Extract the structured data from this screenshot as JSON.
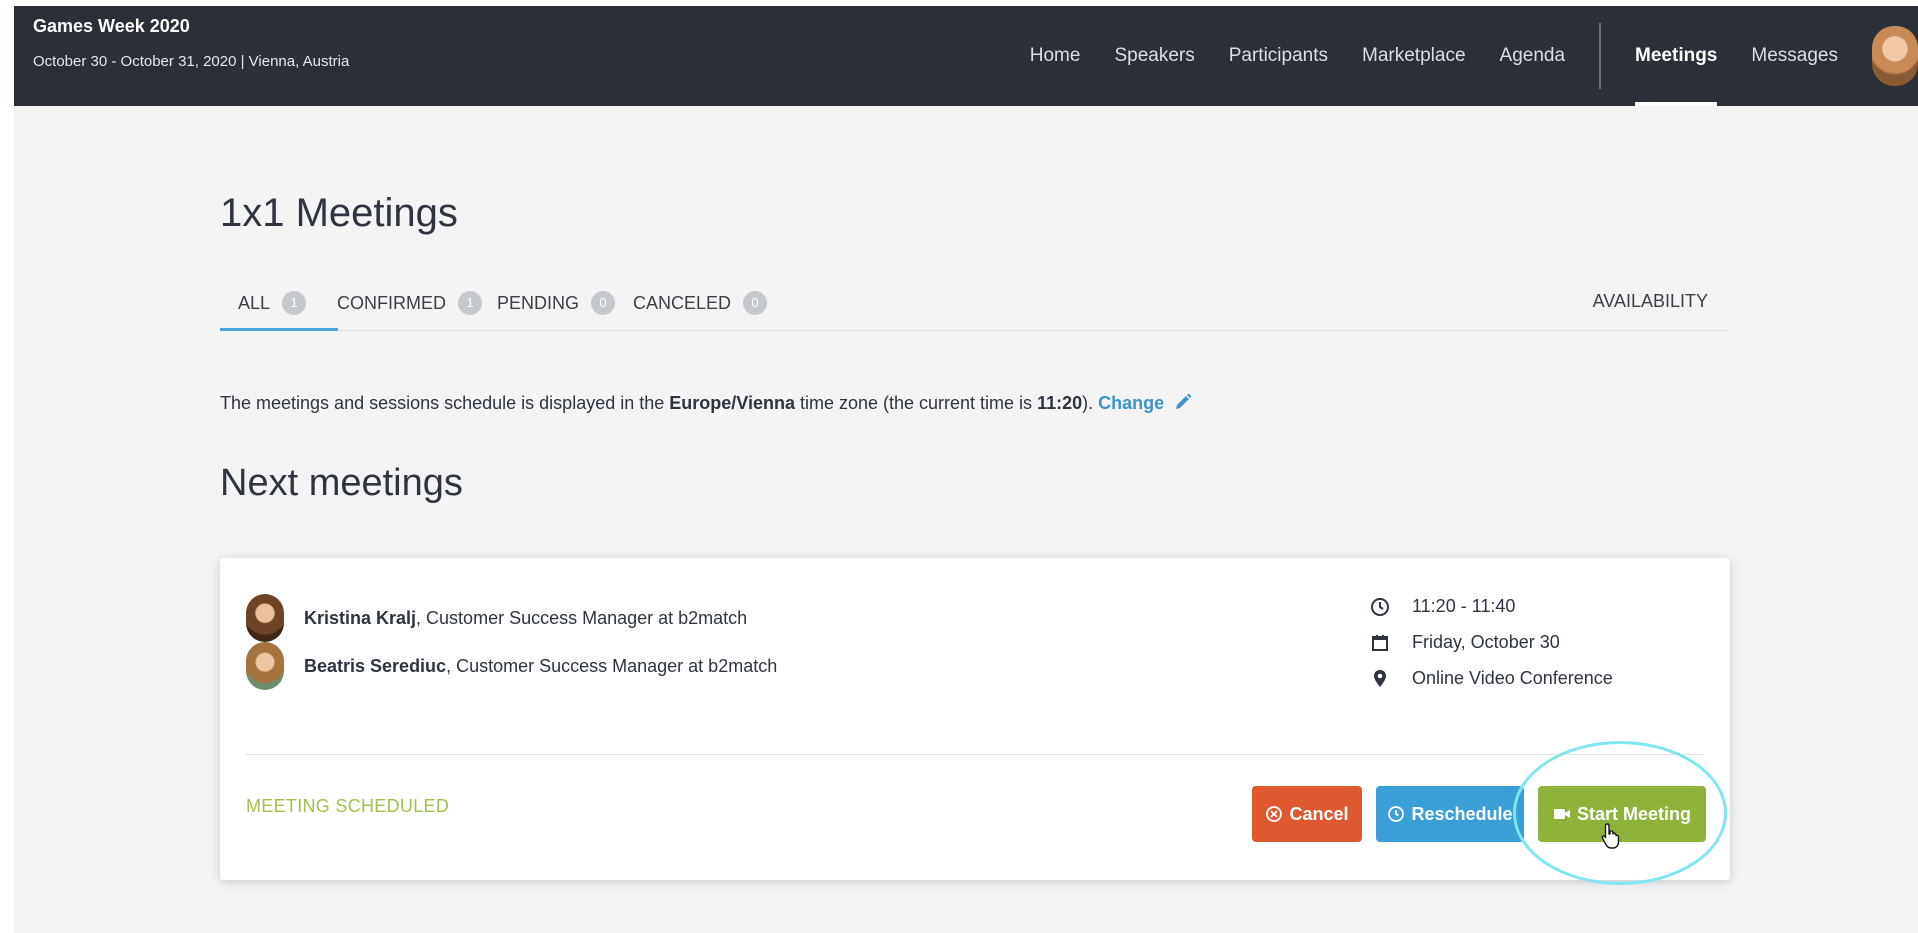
{
  "header": {
    "event_title": "Games Week 2020",
    "event_subtitle": "October 30 - October 31, 2020 | Vienna, Austria",
    "nav": [
      "Home",
      "Speakers",
      "Participants",
      "Marketplace",
      "Agenda"
    ],
    "nav_right": [
      "Meetings",
      "Messages"
    ],
    "active_nav": "Meetings"
  },
  "page": {
    "title": "1x1 Meetings",
    "tabs": [
      {
        "label": "ALL",
        "count": "1"
      },
      {
        "label": "CONFIRMED",
        "count": "1"
      },
      {
        "label": "PENDING",
        "count": "0"
      },
      {
        "label": "CANCELED",
        "count": "0"
      }
    ],
    "availability": "AVAILABILITY",
    "tz_note": {
      "prefix": "The meetings and sessions schedule is displayed in the ",
      "zone": "Europe/Vienna",
      "middle": " time zone (the current time is ",
      "time": "11:20",
      "suffix": "). ",
      "change": "Change"
    },
    "section_title": "Next meetings"
  },
  "meeting": {
    "participants": [
      {
        "name": "Kristina Kralj",
        "role": ", Customer Success Manager at b2match"
      },
      {
        "name": "Beatris Serediuc",
        "role": ", Customer Success Manager at b2match"
      }
    ],
    "time": "11:20 - 11:40",
    "date": "Friday, October 30",
    "location": "Online Video Conference",
    "status": "MEETING SCHEDULED",
    "buttons": {
      "cancel": "Cancel",
      "reschedule": "Reschedule",
      "start": "Start Meeting"
    }
  },
  "colors": {
    "header_bg": "#2b2f38",
    "accent_blue": "#3a9fd6",
    "cancel_orange": "#e0582f",
    "start_green": "#8fb33a",
    "status_green": "#9ec24a"
  }
}
